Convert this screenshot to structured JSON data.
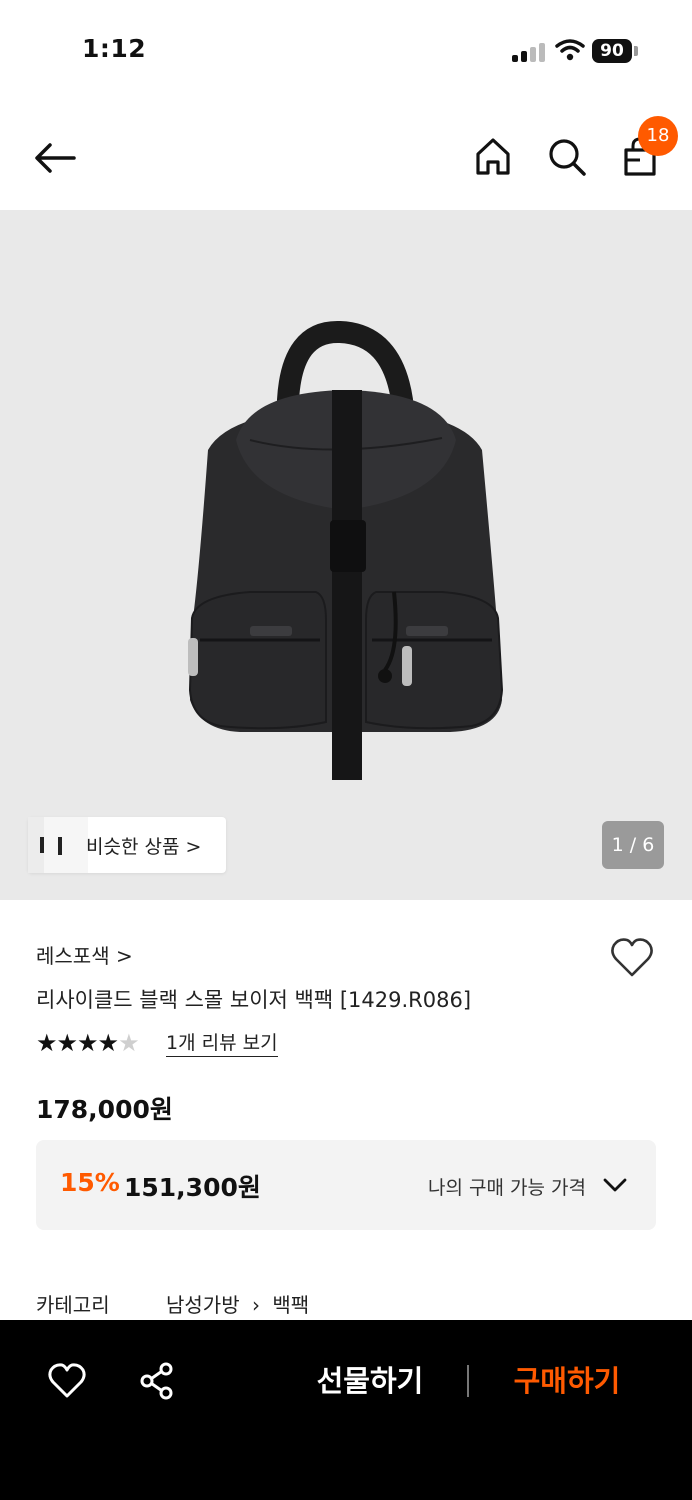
{
  "status_bar": {
    "time": "1:12",
    "battery": "90"
  },
  "header": {
    "back_icon": "arrow-left-icon",
    "home_icon": "home-icon",
    "search_icon": "search-icon",
    "cart_icon": "shopping-bag-icon",
    "cart_count": "18"
  },
  "gallery": {
    "similar_label": "비슷한 상품 >",
    "page_indicator": "1 / 6"
  },
  "product": {
    "brand": "레스포색 >",
    "title": "리사이클드 블랙 스몰 보이저 백팩 [1429.R086]",
    "rating": 4,
    "rating_max": 5,
    "review_link": "1개 리뷰 보기",
    "original_price": "178,000원",
    "discount_rate": "15%",
    "discount_price": "151,300원",
    "my_price_label": "나의 구매 가능 가격",
    "category_label": "카테고리",
    "category_path": [
      "남성가방",
      "백팩"
    ]
  },
  "bottom_bar": {
    "gift_label": "선물하기",
    "buy_label": "구매하기",
    "like_icon": "heart-outline-icon",
    "share_icon": "share-icon"
  },
  "colors": {
    "accent": "#ff5a00",
    "image_background": "#e9e9e9",
    "bottom_bar": "#000000"
  }
}
